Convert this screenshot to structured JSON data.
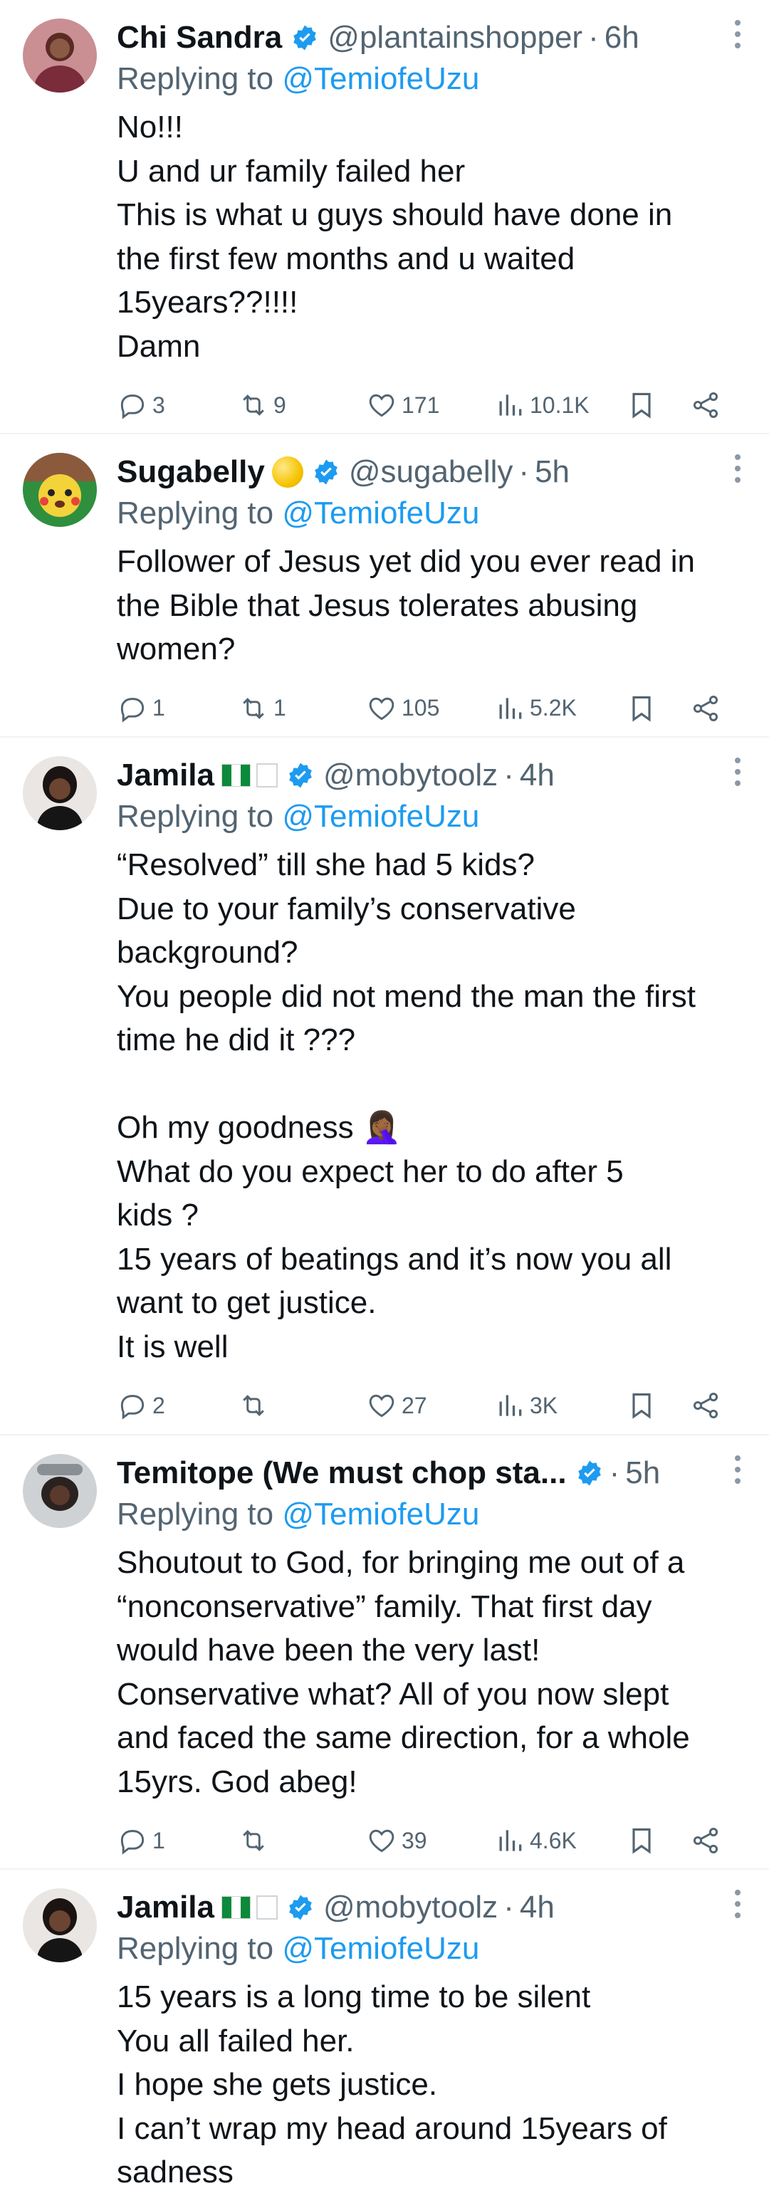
{
  "replying_prefix": "Replying to",
  "tweets": [
    {
      "name": "Chi Sandra",
      "handle": "@plantainshopper",
      "time": "6h",
      "replying_to": "@TemiofeUzu",
      "lines": [
        "No!!!",
        "U and ur family failed her",
        "This is what u guys should have done in",
        "the first few months and u waited",
        "15years??!!!!",
        "Damn"
      ],
      "replies": "3",
      "retweets": "9",
      "likes": "171",
      "views": "10.1K"
    },
    {
      "name": "Sugabelly",
      "handle": "@sugabelly",
      "time": "5h",
      "replying_to": "@TemiofeUzu",
      "lines": [
        "Follower of Jesus yet did you ever read in",
        "the Bible that Jesus tolerates abusing",
        "women?"
      ],
      "replies": "1",
      "retweets": "1",
      "likes": "105",
      "views": "5.2K"
    },
    {
      "name": "Jamila",
      "handle": "@mobytoolz",
      "time": "4h",
      "replying_to": "@TemiofeUzu",
      "lines": [
        "“Resolved” till she had 5 kids?",
        "Due to your family’s conservative",
        "background?",
        "You people did not mend the man the first",
        "time he did it ???",
        "",
        "Oh my goodness 🤦🏾‍♀️",
        "What do you expect her to do after 5",
        "kids ?",
        "15 years of beatings and it’s now you all",
        "want to get justice.",
        "It is well"
      ],
      "replies": "2",
      "retweets": "",
      "likes": "27",
      "views": "3K"
    },
    {
      "name": "Temitope (We must chop sta...",
      "handle": "",
      "time": "5h",
      "replying_to": "@TemiofeUzu",
      "lines": [
        "Shoutout to God, for bringing me out of a",
        "“nonconservative” family. That first day",
        "would have been the very last!",
        "Conservative what? All of you now slept",
        "and faced the same direction, for a whole",
        "15yrs. God abeg!"
      ],
      "replies": "1",
      "retweets": "",
      "likes": "39",
      "views": "4.6K"
    },
    {
      "name": "Jamila",
      "handle": "@mobytoolz",
      "time": "4h",
      "replying_to": "@TemiofeUzu",
      "lines": [
        "15 years is a long time to be silent",
        "You all failed her.",
        "I hope she gets justice.",
        "I can’t wrap my head around 15years of",
        "sadness"
      ]
    }
  ],
  "icons": [
    "reply-icon",
    "retweet-icon",
    "like-icon",
    "views-icon",
    "bookmark-icon",
    "share-icon",
    "verified-badge-icon",
    "more-options-icon"
  ],
  "colors": {
    "link": "#1d9bf0",
    "verified": "#1d9bf0",
    "secondary_text": "#536471",
    "divider": "#eff3f4"
  }
}
